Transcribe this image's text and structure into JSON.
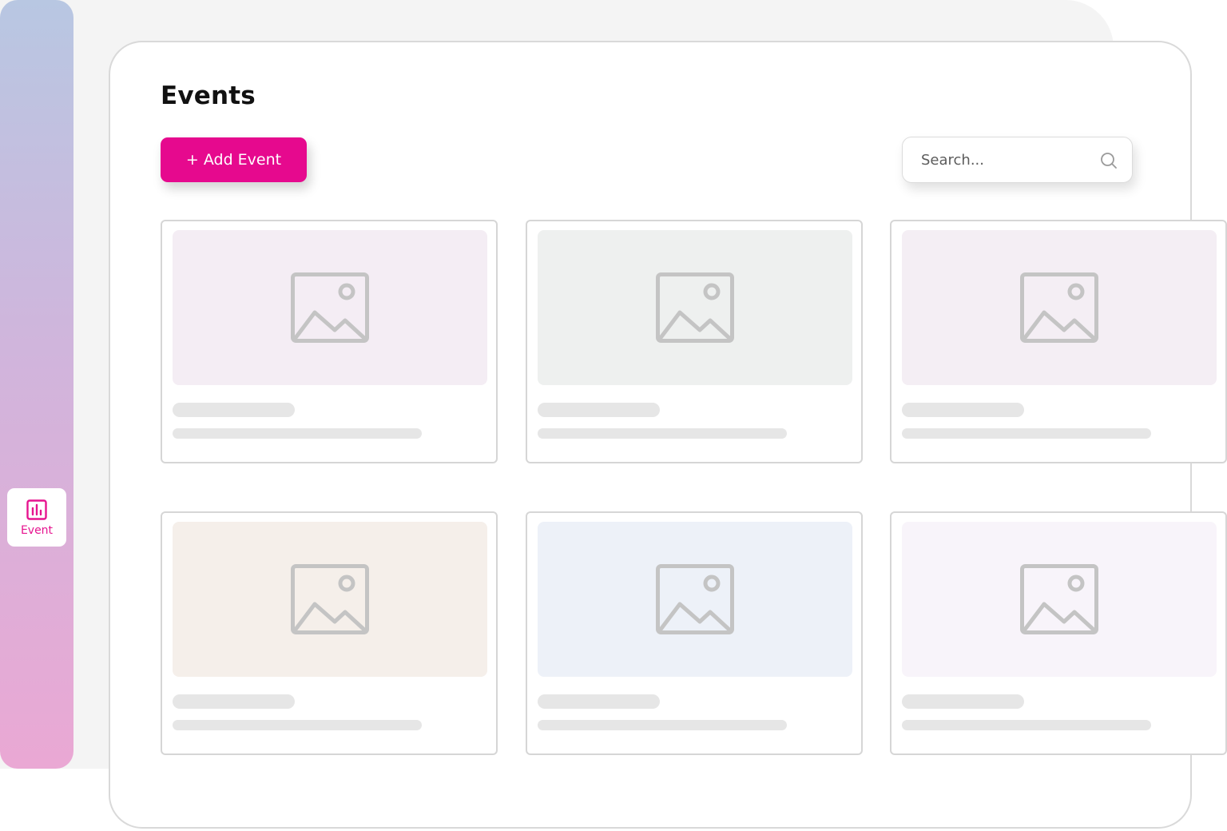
{
  "sidebar": {
    "items": [
      {
        "label": "Event",
        "icon": "bar-chart-icon",
        "active": true,
        "color": "#e6148f"
      }
    ]
  },
  "page": {
    "title": "Events"
  },
  "toolbar": {
    "add_label": "+ Add Event",
    "add_color": "#e6098e"
  },
  "search": {
    "placeholder": "Search...",
    "value": ""
  },
  "cards": [
    {
      "thumb_color": "#f4edf4",
      "icon": "image-placeholder-icon"
    },
    {
      "thumb_color": "#eef0ef",
      "icon": "image-placeholder-icon"
    },
    {
      "thumb_color": "#f4eef4",
      "icon": "image-placeholder-icon"
    },
    {
      "thumb_color": "#f5efea",
      "icon": "image-placeholder-icon"
    },
    {
      "thumb_color": "#edf1f8",
      "icon": "image-placeholder-icon"
    },
    {
      "thumb_color": "#f8f4fa",
      "icon": "image-placeholder-icon"
    }
  ]
}
